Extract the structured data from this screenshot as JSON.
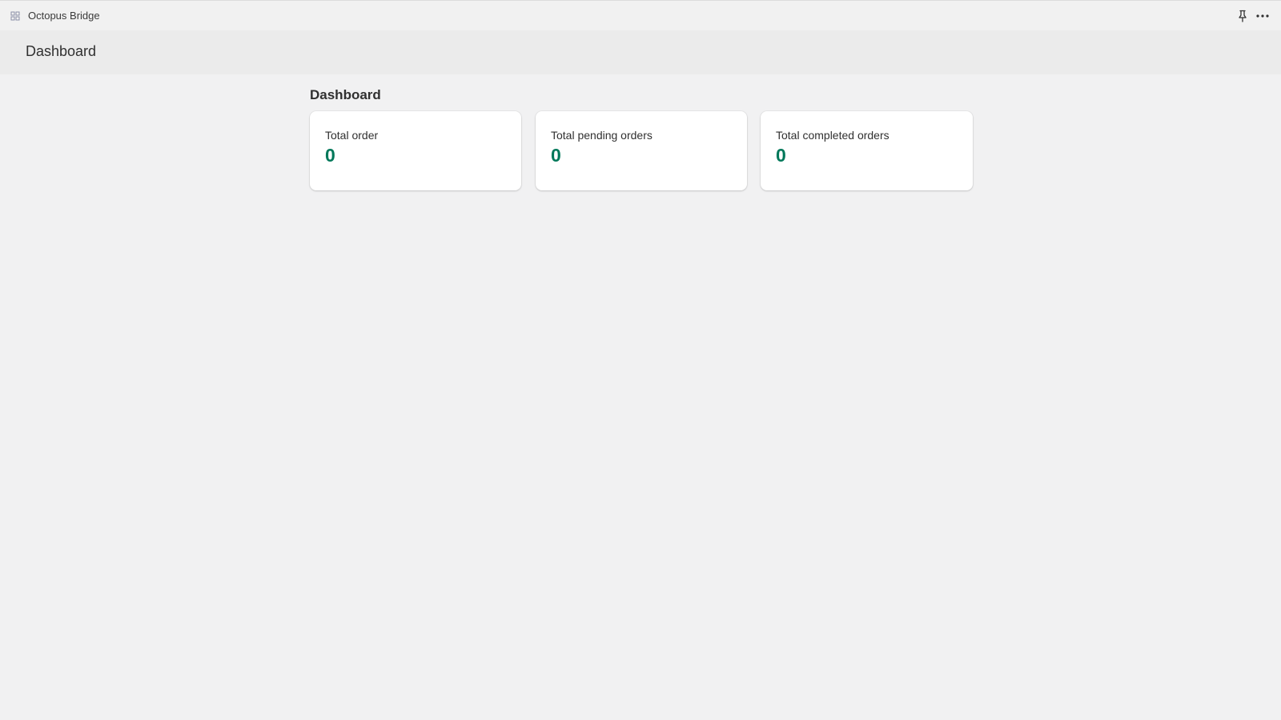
{
  "app": {
    "title": "Octopus Bridge",
    "icon": "app-grid-icon"
  },
  "toolbar": {
    "pin_icon": "pin-icon",
    "more_icon": "more-icon"
  },
  "page_header": {
    "title": "Dashboard"
  },
  "main": {
    "section_title": "Dashboard",
    "cards": [
      {
        "label": "Total order",
        "value": "0"
      },
      {
        "label": "Total pending orders",
        "value": "0"
      },
      {
        "label": "Total completed orders",
        "value": "0"
      }
    ]
  },
  "colors": {
    "metric_value": "#00785a",
    "background": "#f1f1f2",
    "card_background": "#ffffff"
  }
}
